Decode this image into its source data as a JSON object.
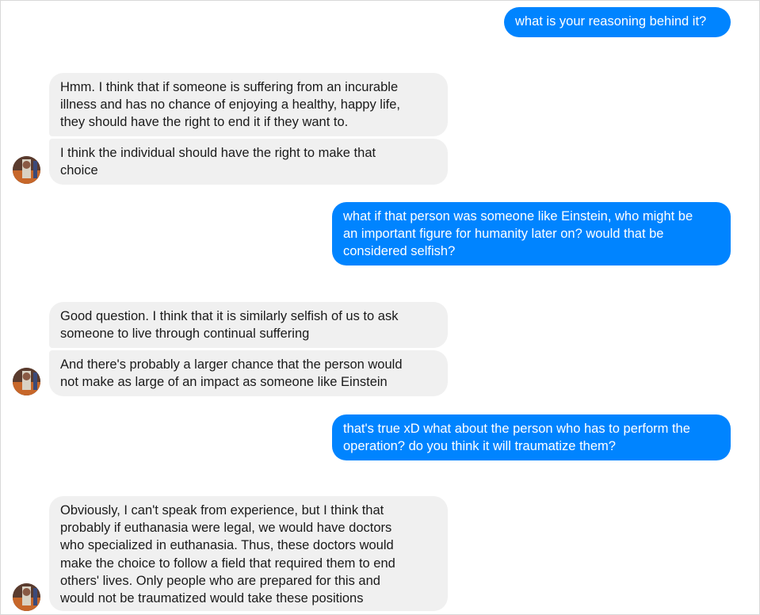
{
  "conversation": {
    "messages": [
      {
        "sender": "me",
        "text": "what is your reasoning behind it?"
      },
      {
        "sender": "them",
        "text": "Hmm.  I think that if someone is suffering from an incurable\nillness and has no chance of enjoying a healthy, happy life,\nthey should have the right to end it if they want to."
      },
      {
        "sender": "them",
        "text": "I think the individual should have the right to make that\nchoice"
      },
      {
        "sender": "me",
        "text": "what if that person was someone like Einstein, who might be\nan important figure for humanity later on? would that be\nconsidered selfish?"
      },
      {
        "sender": "them",
        "text": "Good question. I think that it is similarly selfish of us to ask\nsomeone to live through continual suffering"
      },
      {
        "sender": "them",
        "text": "And there's probably a larger chance that the person would\nnot make as large of an impact as someone like Einstein"
      },
      {
        "sender": "me",
        "text": "that's true xD what about the person who has to perform the\noperation? do you think it will traumatize them?"
      },
      {
        "sender": "them",
        "text": "Obviously, I can't speak from experience, but I think that\nprobably if euthanasia were legal, we would have doctors\nwho specialized in euthanasia.  Thus, these doctors would\nmake the choice to follow a field that required them to end\nothers' lives. Only people who are prepared for this and\nwould not be traumatized would take these positions"
      }
    ]
  },
  "colors": {
    "outgoing_bubble": "#0084ff",
    "incoming_bubble": "#f0f0f0",
    "outgoing_text": "#ffffff",
    "incoming_text": "#1a1a1a"
  },
  "icons": {
    "avatar": "contact-avatar"
  }
}
